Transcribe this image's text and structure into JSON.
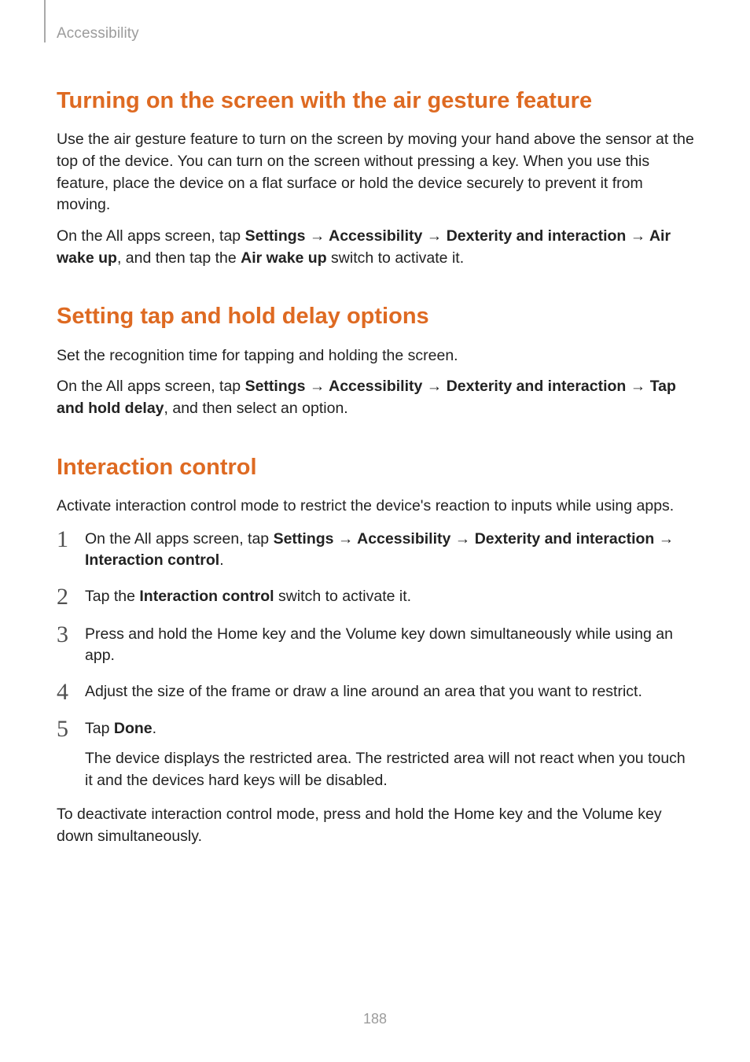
{
  "breadcrumb": "Accessibility",
  "section1": {
    "heading": "Turning on the screen with the air gesture feature",
    "p1": "Use the air gesture feature to turn on the screen by moving your hand above the sensor at the top of the device. You can turn on the screen without pressing a key. When you use this feature, place the device on a flat surface or hold the device securely to prevent it from moving.",
    "p2a": "On the All apps screen, tap ",
    "p2_b1": "Settings",
    "p2_arr": " → ",
    "p2_b2": "Accessibility",
    "p2_b3": "Dexterity and interaction",
    "p2_b4": "Air wake up",
    "p2b": ", and then tap the ",
    "p2_b5": "Air wake up",
    "p2c": " switch to activate it."
  },
  "section2": {
    "heading": "Setting tap and hold delay options",
    "p1": "Set the recognition time for tapping and holding the screen.",
    "p2a": "On the All apps screen, tap ",
    "p2_b1": "Settings",
    "p2_arr": " → ",
    "p2_b2": "Accessibility",
    "p2_b3": "Dexterity and interaction",
    "p2_b4": "Tap and hold delay",
    "p2b": ", and then select an option."
  },
  "section3": {
    "heading": "Interaction control",
    "p1": "Activate interaction control mode to restrict the device's reaction to inputs while using apps.",
    "steps": {
      "n1": "1",
      "s1a": "On the All apps screen, tap ",
      "s1_b1": "Settings",
      "s1_arr": " → ",
      "s1_b2": "Accessibility",
      "s1_b3": "Dexterity and interaction",
      "s1_b4": "Interaction control",
      "s1b": ".",
      "n2": "2",
      "s2a": "Tap the ",
      "s2_b1": "Interaction control",
      "s2b": " switch to activate it.",
      "n3": "3",
      "s3": "Press and hold the Home key and the Volume key down simultaneously while using an app.",
      "n4": "4",
      "s4": "Adjust the size of the frame or draw a line around an area that you want to restrict.",
      "n5": "5",
      "s5a": "Tap ",
      "s5_b1": "Done",
      "s5b": ".",
      "s5sub": "The device displays the restricted area. The restricted area will not react when you touch it and the devices hard keys will be disabled."
    },
    "p_after": "To deactivate interaction control mode, press and hold the Home key and the Volume key down simultaneously."
  },
  "page_number": "188"
}
